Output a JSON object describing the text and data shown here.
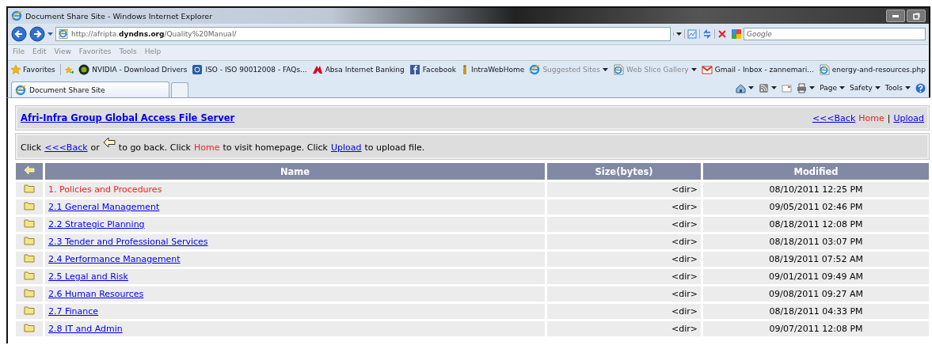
{
  "window": {
    "title": "Document Share Site - Windows Internet Explorer"
  },
  "address_bar": {
    "url": "http://afripta.**dyndns.org**/Quality%20Manual/"
  },
  "search": {
    "placeholder": "Google"
  },
  "menu": [
    "File",
    "Edit",
    "View",
    "Favorites",
    "Tools",
    "Help"
  ],
  "favorites_bar": {
    "label": "Favorites",
    "items": [
      {
        "label": "NVIDIA - Download Drivers",
        "kind": "disc",
        "disabled": false,
        "dropdown": false
      },
      {
        "label": "ISO - ISO 90012008 - FAQs...",
        "kind": "square",
        "disabled": false,
        "dropdown": false
      },
      {
        "label": "Absa Internet Banking",
        "kind": "mark",
        "disabled": false,
        "dropdown": false
      },
      {
        "label": "Facebook",
        "kind": "letter-square",
        "disabled": false,
        "dropdown": false
      },
      {
        "label": "IntraWebHome",
        "kind": "figure",
        "disabled": false,
        "dropdown": false
      },
      {
        "label": "Suggested Sites",
        "kind": "globe",
        "disabled": true,
        "dropdown": true
      },
      {
        "label": "Web Slice Gallery",
        "kind": "page",
        "disabled": true,
        "dropdown": true
      },
      {
        "label": "Gmail - Inbox - zannemari...",
        "kind": "envelope",
        "disabled": false,
        "dropdown": false
      },
      {
        "label": "energy-and-resources.php",
        "kind": "page",
        "disabled": false,
        "dropdown": false
      }
    ]
  },
  "tabs": [
    {
      "label": "Document Share Site",
      "selected": true
    }
  ],
  "command_bar": [
    "Page",
    "Safety",
    "Tools"
  ],
  "page": {
    "title": "Afri-Infra Group Global Access File Server",
    "nav": [
      {
        "label": "<<<Back",
        "kind": "link"
      },
      {
        "label": "Home",
        "kind": "red"
      },
      {
        "label": "|",
        "kind": "plain"
      },
      {
        "label": "Upload",
        "kind": "link"
      }
    ],
    "instructions": [
      {
        "label": "Click",
        "kind": "plain"
      },
      {
        "label": "<<<Back",
        "kind": "link"
      },
      {
        "label": "or",
        "kind": "plain"
      },
      {
        "kind": "arrow"
      },
      {
        "label": "to go back. Click",
        "kind": "plain"
      },
      {
        "label": "Home",
        "kind": "red"
      },
      {
        "label": "to visit homepage. Click",
        "kind": "plain"
      },
      {
        "label": "Upload",
        "kind": "link"
      },
      {
        "label": "to upload file.",
        "kind": "plain"
      }
    ]
  },
  "table": {
    "columns": [
      "Name",
      "Size(bytes)",
      "Modified"
    ],
    "rows": [
      {
        "name": "1. Policies and Procedures",
        "highlighted": true,
        "size": "<dir>",
        "modified": "08/10/2011 12:25 PM"
      },
      {
        "name": "2.1 General Management",
        "highlighted": false,
        "size": "<dir>",
        "modified": "09/05/2011 02:46 PM"
      },
      {
        "name": "2.2 Strategic Planning",
        "highlighted": false,
        "size": "<dir>",
        "modified": "08/18/2011 12:08 PM"
      },
      {
        "name": "2.3 Tender and Professional Services",
        "highlighted": false,
        "size": "<dir>",
        "modified": "08/18/2011 03:07 PM"
      },
      {
        "name": "2.4 Performance Management",
        "highlighted": false,
        "size": "<dir>",
        "modified": "08/19/2011 07:52 AM"
      },
      {
        "name": "2.5 Legal and Risk",
        "highlighted": false,
        "size": "<dir>",
        "modified": "09/01/2011 09:49 AM"
      },
      {
        "name": "2.6 Human Resources",
        "highlighted": false,
        "size": "<dir>",
        "modified": "09/08/2011 09:27 AM"
      },
      {
        "name": "2.7 Finance",
        "highlighted": false,
        "size": "<dir>",
        "modified": "08/18/2011 04:33 PM"
      },
      {
        "name": "2.8 IT and Admin",
        "highlighted": false,
        "size": "<dir>",
        "modified": "09/07/2011 12:08 PM"
      }
    ]
  }
}
